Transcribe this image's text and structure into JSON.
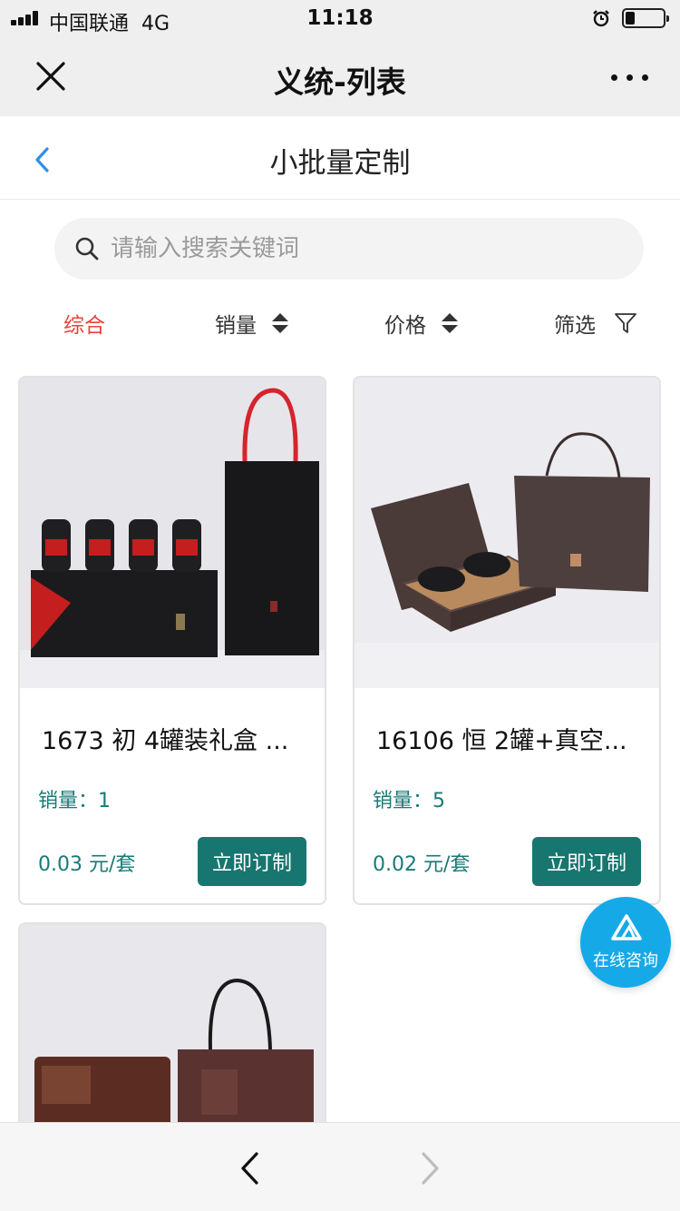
{
  "status_bar": {
    "carrier": "中国联通",
    "network": "4G",
    "time": "11:18",
    "battery_level": 0.25
  },
  "wechat_bar": {
    "title": "义统-列表"
  },
  "header": {
    "title": "小批量定制"
  },
  "search": {
    "placeholder": "请输入搜索关键词",
    "value": ""
  },
  "sort": {
    "items": [
      {
        "label": "综合",
        "active": true
      },
      {
        "label": "销量"
      },
      {
        "label": "价格"
      },
      {
        "label": "筛选"
      }
    ]
  },
  "products": [
    {
      "name": "1673 初 4罐装礼盒 ...",
      "sales": "销量：1",
      "price": "0.03 元/套",
      "button": "立即订制"
    },
    {
      "name": "16106 恒 2罐+真空...",
      "sales": "销量：5",
      "price": "0.02 元/套",
      "button": "立即订制"
    },
    {
      "name": "",
      "sales": "",
      "price": "",
      "button": ""
    }
  ],
  "consult": {
    "label": "在线咨询"
  },
  "colors": {
    "accent": "#17766f",
    "active_sort": "#e5453d",
    "consult": "#16a9e8"
  },
  "icons": [
    "close-icon",
    "more-icon",
    "back-icon",
    "search-icon",
    "sort-arrows-icon",
    "filter-icon",
    "chevron-left-icon",
    "chevron-right-icon"
  ]
}
